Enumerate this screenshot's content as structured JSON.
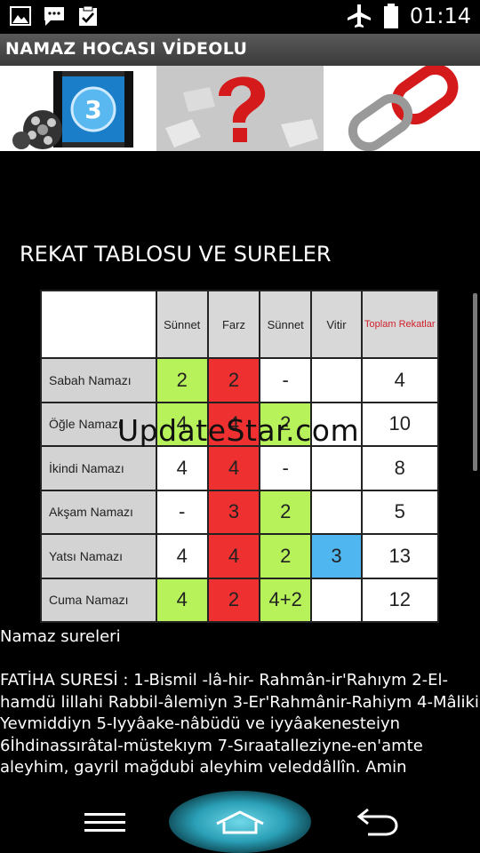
{
  "status_bar": {
    "time": "01:14",
    "icons": [
      "gallery-icon",
      "message-icon",
      "clipboard-check-icon",
      "airplane-mode-icon",
      "battery-icon"
    ]
  },
  "app": {
    "title": "NAMAZ HOCASI VİDEOLU"
  },
  "banner": {
    "items": [
      "film-reel-icon",
      "question-mark-icon",
      "chain-link-icon"
    ]
  },
  "content": {
    "heading": "REKAT TABLOSU VE SURELER",
    "watermark": "UpdateStar.com",
    "table": {
      "headers": [
        "",
        "Sünnet",
        "Farz",
        "Sünnet",
        "Vitir",
        "Toplam Rekatlar"
      ],
      "rows": [
        {
          "label": "Sabah Namazı",
          "cells": [
            "2",
            "2",
            "-",
            "",
            "4"
          ]
        },
        {
          "label": "Öğle Namazı",
          "cells": [
            "4",
            "4",
            "2",
            "",
            "10"
          ]
        },
        {
          "label": "İkindi Namazı",
          "cells": [
            "4",
            "4",
            "-",
            "",
            "8"
          ]
        },
        {
          "label": "Akşam Namazı",
          "cells": [
            "-",
            "3",
            "2",
            "",
            "5"
          ]
        },
        {
          "label": "Yatsı Namazı",
          "cells": [
            "4",
            "4",
            "2",
            "3",
            "13"
          ]
        },
        {
          "label": "Cuma Namazı",
          "cells": [
            "4",
            "2",
            "4+2",
            "",
            "12"
          ]
        }
      ]
    },
    "subheading": "Namaz sureleri",
    "body": " FATİHA SURESİ : 1-Bismil -lâ-hir- Rahmân-ir'Rahıym 2-El-hamdü lillahi Rabbil-âlemiyn 3-Er'Rahmânir-Rahiym 4-Mâliki Yevmiddiyn 5-Iyyâake-nâbüdü ve iyyâakenesteiyn 6İhdinassırâtal-müstekıym 7-Sıraatalleziyne-en'amte aleyhim, gayril mağdubi aleyhim veleddâllîn. Amin"
  },
  "nav": {
    "menu_icon": "menu-icon",
    "home_icon": "home-icon",
    "back_icon": "back-icon"
  },
  "colors": {
    "green_cell": "#b7f25a",
    "red_cell": "#ee3030",
    "blue_cell": "#4fb6f0",
    "title_bar": "#4a4a4a",
    "total_header": "#d0202a"
  }
}
